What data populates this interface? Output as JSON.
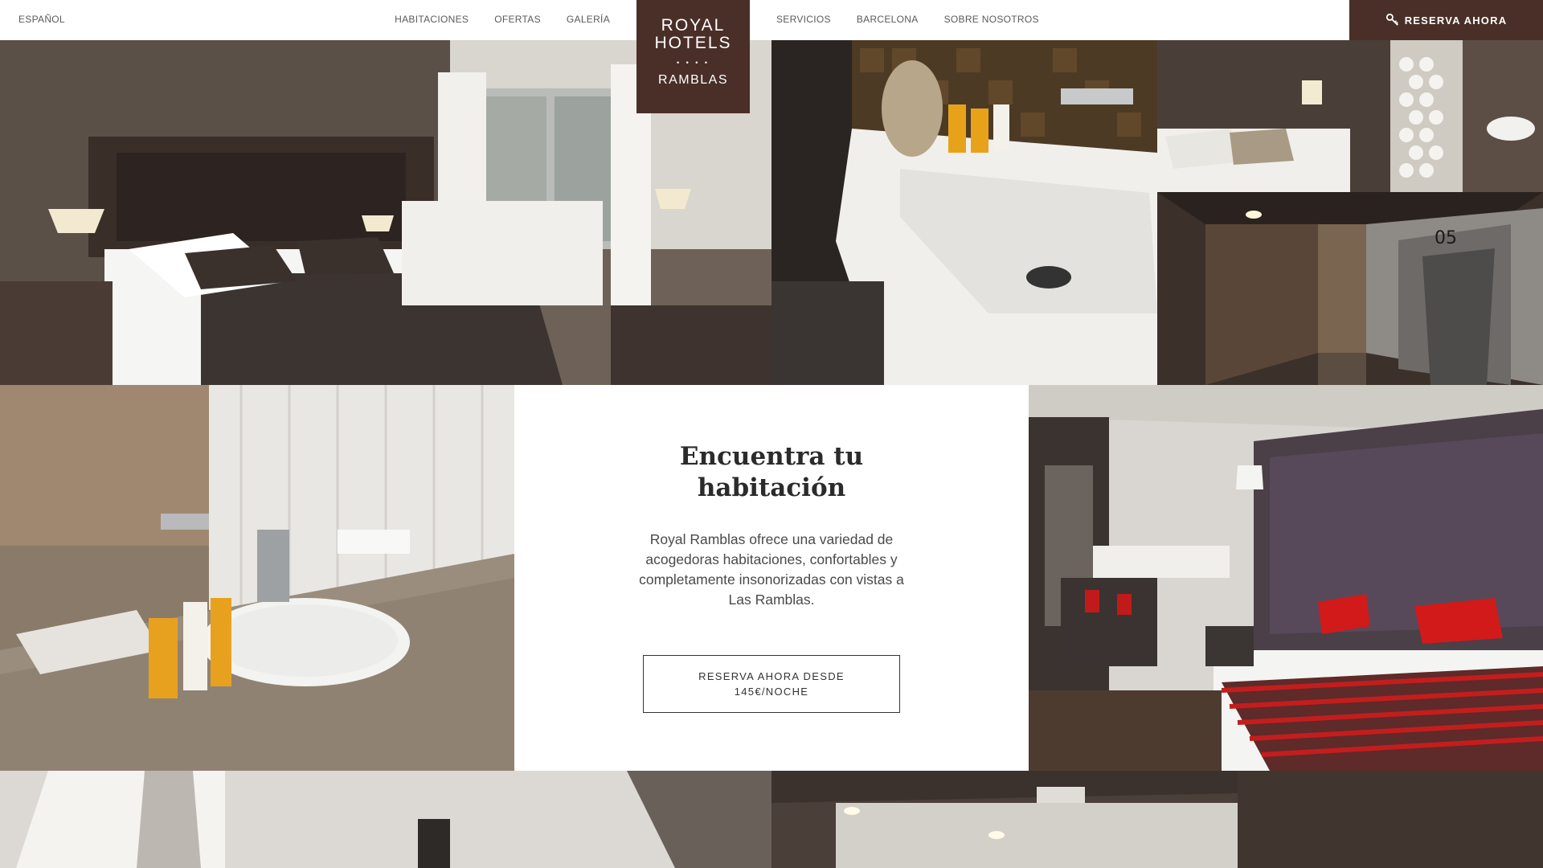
{
  "header": {
    "language": "ESPAÑOL",
    "nav_left": [
      "HABITACIONES",
      "OFERTAS",
      "GALERÍA"
    ],
    "nav_right": [
      "SERVICIOS",
      "BARCELONA",
      "SOBRE NOSOTROS"
    ],
    "logo": {
      "line1": "ROYAL",
      "line2": "HOTELS",
      "dots": "• • • •",
      "line3": "RAMBLAS"
    },
    "cta": "RESERVA AHORA"
  },
  "photos": {
    "room_main": "habitación doble con cama",
    "bathroom_sink": "lavabo blanco",
    "room_small": "habitación",
    "corridor": "pasillo",
    "corridor_number": "05",
    "sink_amenities": "lavabo con amenities",
    "room_red": "habitación con cojines rojos",
    "bottom_left": "baño",
    "bottom_right": "habitación"
  },
  "intro": {
    "title": "Encuentra tu habitación",
    "body": "Royal Ramblas ofrece una variedad de acogedoras habitaciones, confortables y completamente insonorizadas con vistas a Las Ramblas.",
    "button_line1": "RESERVA AHORA DESDE",
    "button_line2": "145€/NOCHE"
  },
  "colors": {
    "brand": "#4a2f28",
    "header_bg": "#ffffff",
    "nav_text": "#5a5a5a",
    "title_text": "#2b2b2b"
  }
}
